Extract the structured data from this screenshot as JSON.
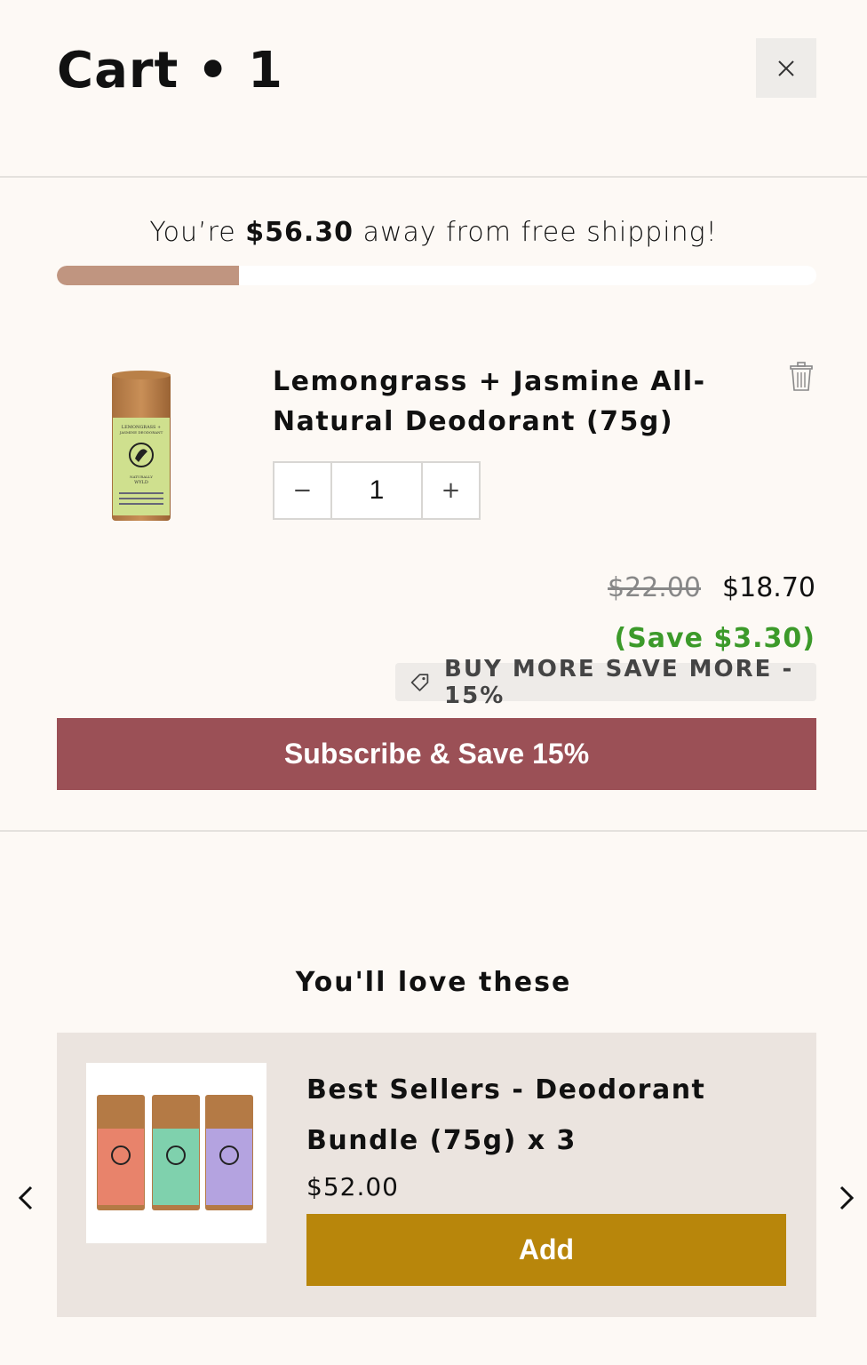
{
  "header": {
    "title": "Cart • 1",
    "close_icon": "close-icon"
  },
  "shipping": {
    "prefix": "You’re ",
    "amount": "$56.30",
    "suffix": " away from free shipping!",
    "progress_fraction": 0.24,
    "progress_color": "#c09580"
  },
  "cart_item": {
    "title": "Lemongrass + Jasmine All-Natural Deodorant (75g)",
    "quantity": "1",
    "decrement_label": "−",
    "increment_label": "+",
    "original_price": "$22.00",
    "price": "$18.70",
    "savings": "(Save $3.30)",
    "promo": "BUY MORE SAVE MORE - 15%",
    "product_image_label_lines": [
      "LEMONGRASS +",
      "JASMINE DEODORANT",
      "NATURALLY",
      "WYLD"
    ]
  },
  "subscribe_button": "Subscribe & Save 15%",
  "recommendations": {
    "heading": "You'll love these",
    "items": [
      {
        "title": "Best Sellers - Deodorant Bundle (75g) x 3",
        "price": "$52.00",
        "add_label": "Add"
      }
    ]
  },
  "colors": {
    "background": "#fdf9f5",
    "subscribe": "#9b5056",
    "add": "#b8860b",
    "savings": "#3c9a2a"
  }
}
